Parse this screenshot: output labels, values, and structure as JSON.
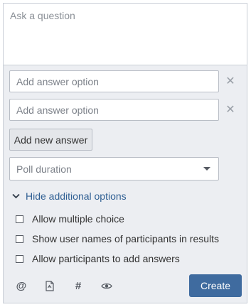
{
  "question": {
    "placeholder": "Ask a question"
  },
  "answers": [
    {
      "placeholder": "Add answer option",
      "remove_icon": "close-icon"
    },
    {
      "placeholder": "Add answer option",
      "remove_icon": "close-icon"
    }
  ],
  "add_answer_label": "Add new answer",
  "poll_duration": {
    "placeholder": "Poll duration",
    "icon": "chevron-down-icon"
  },
  "additional_options": {
    "toggle_label": "Hide additional options",
    "toggle_icon": "chevron-down-icon",
    "options": [
      {
        "label": "Allow multiple choice",
        "checked": false
      },
      {
        "label": "Show user names of participants in results",
        "checked": false
      },
      {
        "label": "Allow participants to add answers",
        "checked": false
      }
    ]
  },
  "toolbar": {
    "icons": [
      "at-mention-icon",
      "file-attachment-icon",
      "hashtag-icon",
      "preview-eye-icon"
    ],
    "create_label": "Create"
  },
  "colors": {
    "panel_bg": "#eceef2",
    "link": "#2f5f93",
    "primary_button": "#3f6b9f"
  }
}
